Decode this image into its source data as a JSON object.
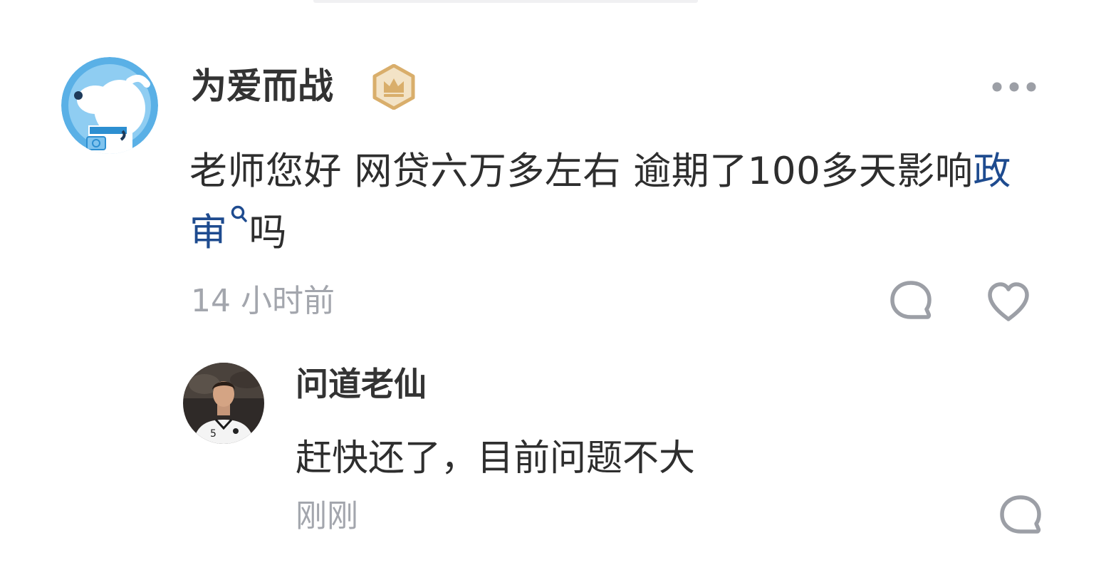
{
  "comment": {
    "author": "为爱而战",
    "badge_icon": "crown-badge-icon",
    "text_before_link": "老师您好 网贷六万多左右 逾期了100多天影响",
    "link_text": "政审",
    "text_after_link": "吗",
    "time": "14 小时前",
    "actions": {
      "more_icon": "more-dots-icon",
      "reply_icon": "comment-bubble-icon",
      "like_icon": "heart-icon"
    }
  },
  "reply": {
    "author": "问道老仙",
    "text": "赶快还了，目前问题不大",
    "time": "刚刚",
    "actions": {
      "reply_icon": "comment-bubble-icon"
    }
  },
  "colors": {
    "link": "#1e4b8f",
    "meta_gray": "#a3a6ad",
    "badge_gold": "#d9ae6b",
    "avatar_blue": "#5ab0e6"
  }
}
